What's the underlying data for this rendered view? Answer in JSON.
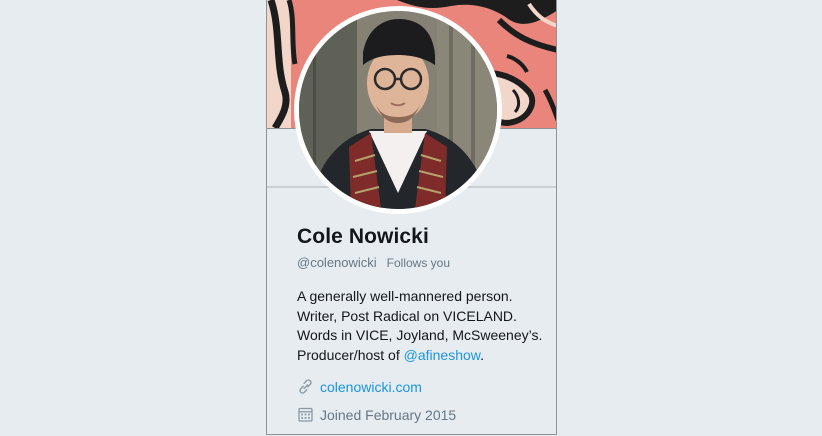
{
  "profile": {
    "name": "Cole Nowicki",
    "handle": "@colenowicki",
    "follows_you": "Follows you",
    "bio": {
      "line1": "A generally well-mannered person.",
      "line2": "Writer, Post Radical on VICELAND.",
      "line3": "Words in VICE, Joyland, McSweeney’s.",
      "line4_prefix": "Producer/host of ",
      "mention": "@afineshow",
      "line4_suffix": "."
    },
    "website": "colenowicki.com",
    "joined": "Joined February 2015"
  },
  "icons": {
    "website": "link-icon",
    "joined": "calendar-icon"
  },
  "colors": {
    "background": "#e6ecf0",
    "link": "#1b95e0",
    "text": "#14171a",
    "muted": "#657786",
    "banner": "#e9857a"
  }
}
